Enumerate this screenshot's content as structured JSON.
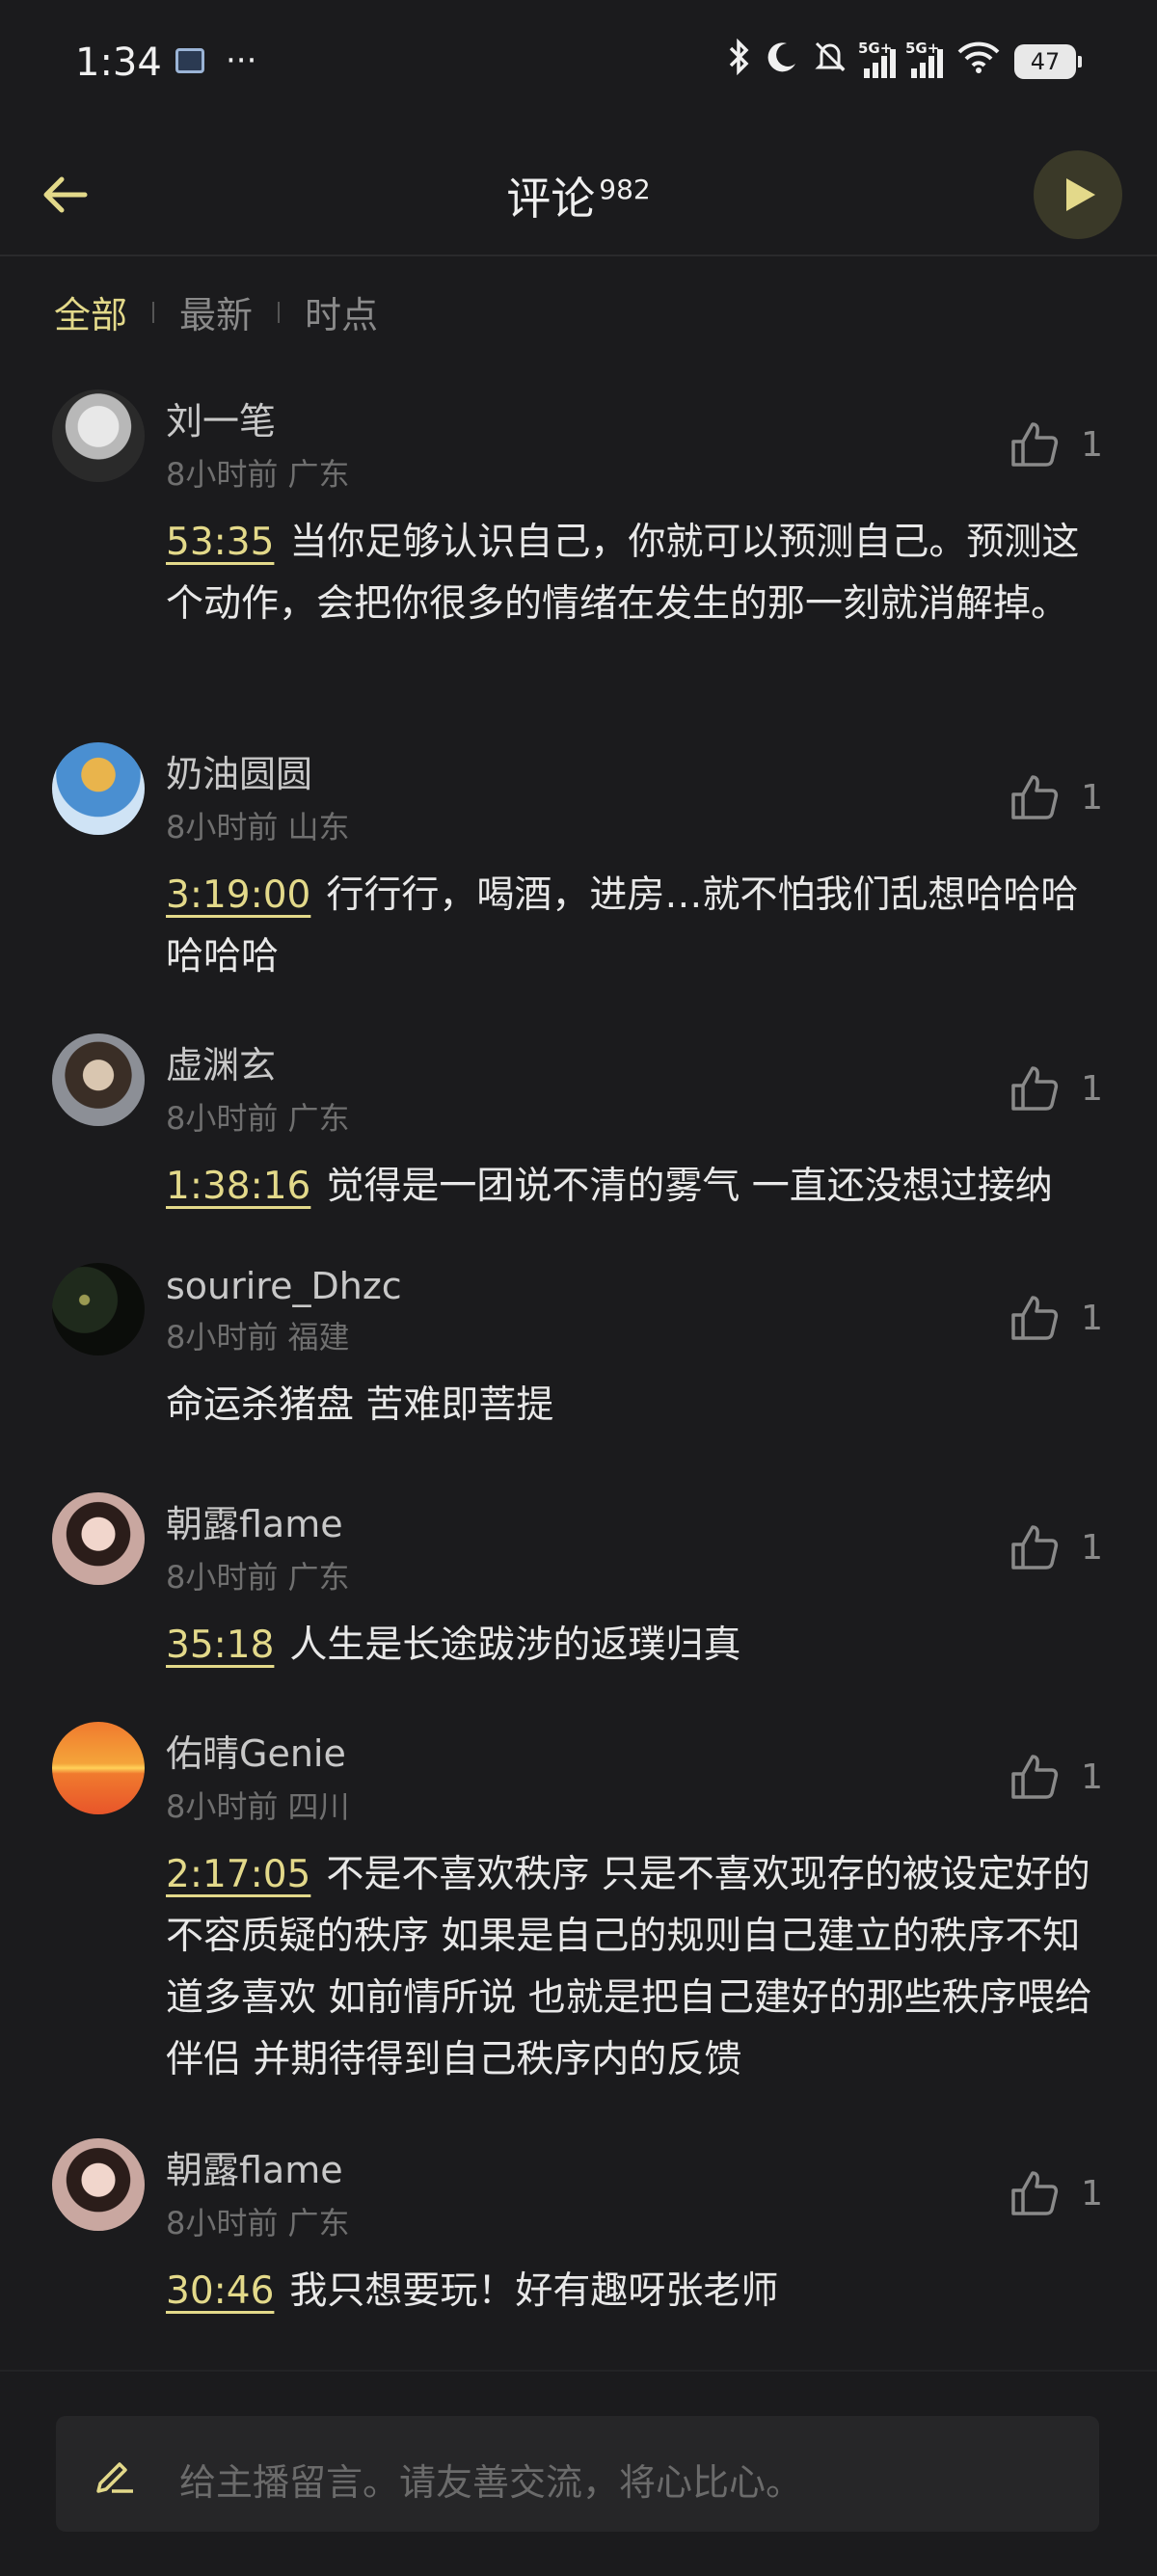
{
  "status_bar": {
    "time": "1:34",
    "dots": "···",
    "signal1_tag": "5G+",
    "signal2_tag": "5G+",
    "battery": "47"
  },
  "header": {
    "title": "评论",
    "count": "982"
  },
  "tabs": [
    {
      "label": "全部",
      "active": true
    },
    {
      "label": "最新",
      "active": false
    },
    {
      "label": "时点",
      "active": false
    }
  ],
  "comments": [
    {
      "user": "刘一笔",
      "meta": "8小时前 广东",
      "likes": "1",
      "timestamp": "53:35",
      "text": "当你足够认识自己，你就可以预测自己。预测这个动作，会把你很多的情绪在发生的那一刻就消解掉。"
    },
    {
      "user": "奶油圆圆",
      "meta": "8小时前 山东",
      "likes": "1",
      "timestamp": "3:19:00",
      "text": "行行行，喝酒，进房…就不怕我们乱想哈哈哈哈哈哈"
    },
    {
      "user": "虚渊玄",
      "meta": "8小时前 广东",
      "likes": "1",
      "timestamp": "1:38:16",
      "text": "觉得是一团说不清的雾气 一直还没想过接纳"
    },
    {
      "user": "sourire_Dhzc",
      "meta": "8小时前 福建",
      "likes": "1",
      "timestamp": "",
      "text": "命运杀猪盘 苦难即菩提"
    },
    {
      "user": "朝露flame",
      "meta": "8小时前 广东",
      "likes": "1",
      "timestamp": "35:18",
      "text": "人生是长途跋涉的返璞归真"
    },
    {
      "user": "佑晴Genie",
      "meta": "8小时前 四川",
      "likes": "1",
      "timestamp": "2:17:05",
      "text": "不是不喜欢秩序 只是不喜欢现存的被设定好的不容质疑的秩序 如果是自己的规则自己建立的秩序不知道多喜欢 如前情所说 也就是把自己建好的那些秩序喂给伴侣 并期待得到自己秩序内的反馈"
    },
    {
      "user": "朝露flame",
      "meta": "8小时前 广东",
      "likes": "1",
      "timestamp": "30:46",
      "text": "我只想要玩！好有趣呀张老师"
    }
  ],
  "input": {
    "placeholder": "给主播留言。请友善交流，将心比心。"
  },
  "colors": {
    "accent": "#e3d98a",
    "background": "#1b1b1d"
  }
}
